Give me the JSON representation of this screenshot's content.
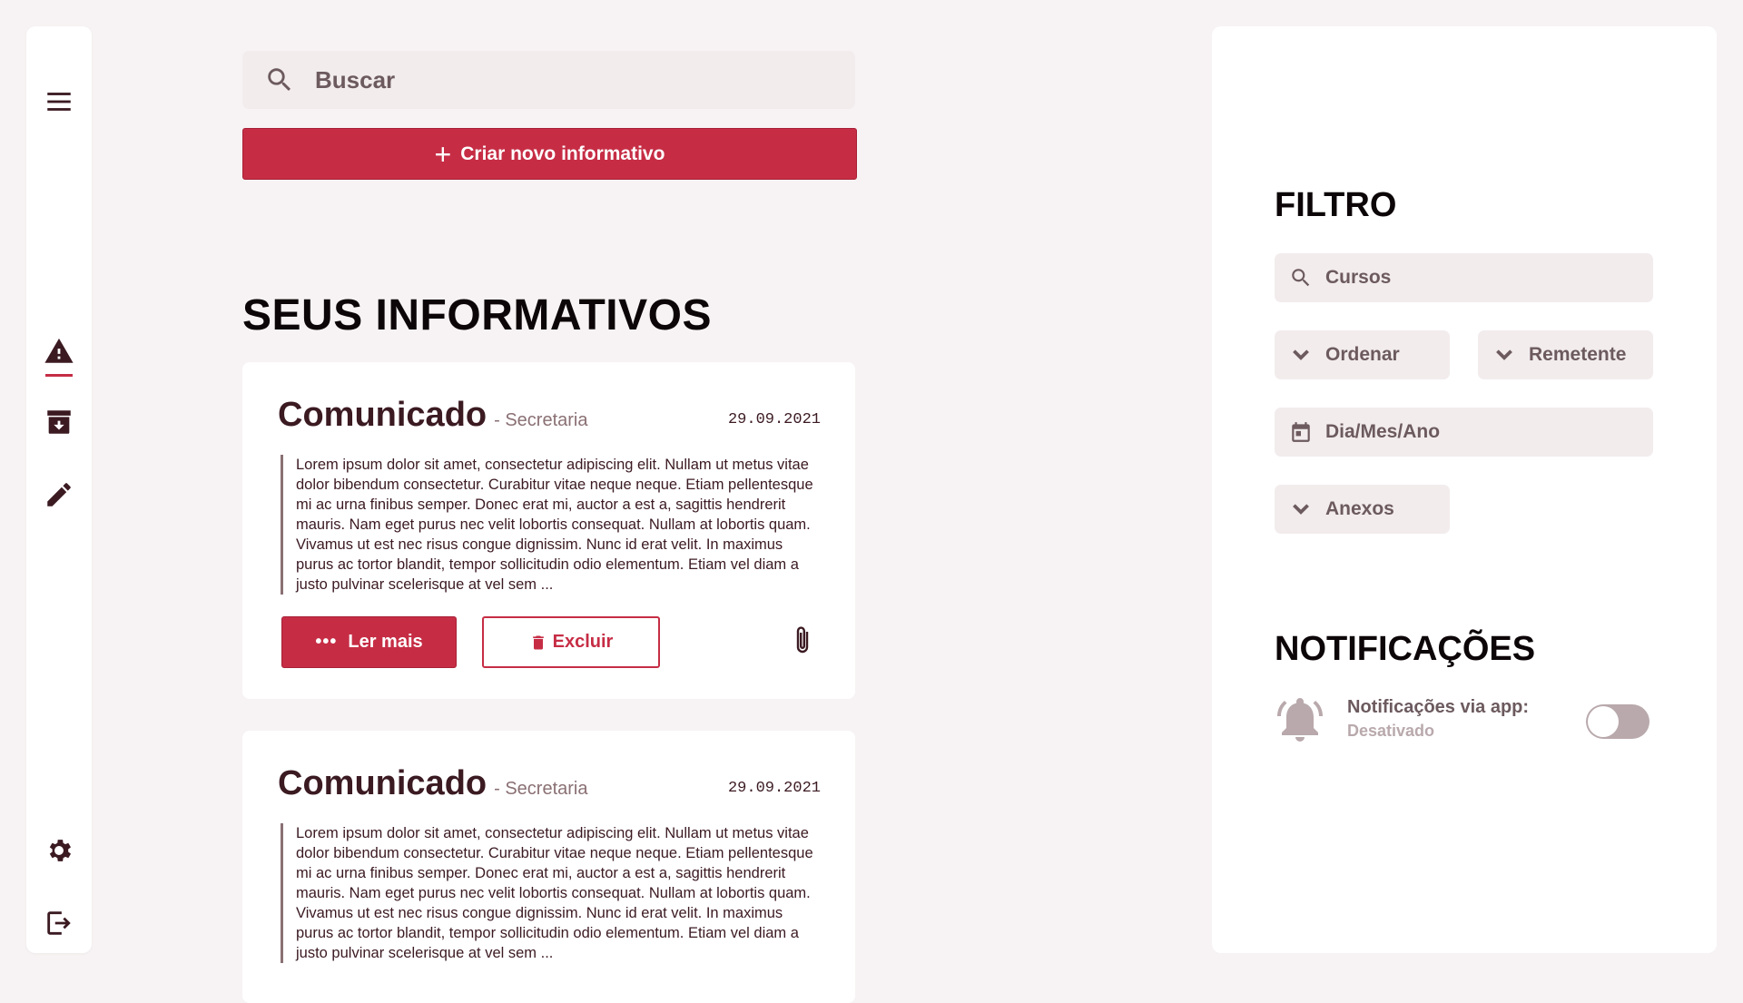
{
  "search": {
    "placeholder": "Buscar"
  },
  "create_button": {
    "label": "Criar novo informativo"
  },
  "section_title": "SEUS INFORMATIVOS",
  "cards": [
    {
      "title": "Comunicado",
      "sender": "- Secretaria",
      "date": "29.09.2021",
      "body": "Lorem ipsum dolor sit amet, consectetur adipiscing elit. Nullam ut metus vitae dolor bibendum consectetur. Curabitur vitae neque neque. Etiam pellentesque mi ac urna finibus semper. Donec erat mi, auctor a est a, sagittis hendrerit mauris. Nam eget purus nec velit lobortis consequat. Nullam at lobortis quam. Vivamus ut est nec risus congue dignissim. Nunc id erat velit. In maximus purus ac tortor blandit, tempor sollicitudin odio elementum. Etiam vel diam a justo pulvinar scelerisque at vel sem ...",
      "read_more_label": "Ler mais",
      "delete_label": "Excluir"
    },
    {
      "title": "Comunicado",
      "sender": "- Secretaria",
      "date": "29.09.2021",
      "body": "Lorem ipsum dolor sit amet, consectetur adipiscing elit. Nullam ut metus vitae dolor bibendum consectetur. Curabitur vitae neque neque. Etiam pellentesque mi ac urna finibus semper. Donec erat mi, auctor a est a, sagittis hendrerit mauris. Nam eget purus nec velit lobortis consequat. Nullam at lobortis quam. Vivamus ut est nec risus congue dignissim. Nunc id erat velit. In maximus purus ac tortor blandit, tempor sollicitudin odio elementum. Etiam vel diam a justo pulvinar scelerisque at vel sem ..."
    }
  ],
  "filter": {
    "heading": "FILTRO",
    "courses": "Cursos",
    "order": "Ordenar",
    "sender": "Remetente",
    "date": "Dia/Mes/Ano",
    "attachments": "Anexos"
  },
  "notifications": {
    "heading": "NOTIFICAÇÕES",
    "label": "Notificações via app:",
    "status": "Desativado",
    "enabled": false
  },
  "sidebar": {
    "icons": [
      "menu-icon",
      "warning-icon",
      "archive-icon",
      "edit-icon",
      "settings-icon",
      "logout-icon"
    ]
  },
  "colors": {
    "accent": "#c62d45",
    "text_dark": "#3b1a22",
    "muted": "#6c5a5e",
    "field_bg": "#f2eced",
    "page_bg": "#f7f3f4"
  }
}
